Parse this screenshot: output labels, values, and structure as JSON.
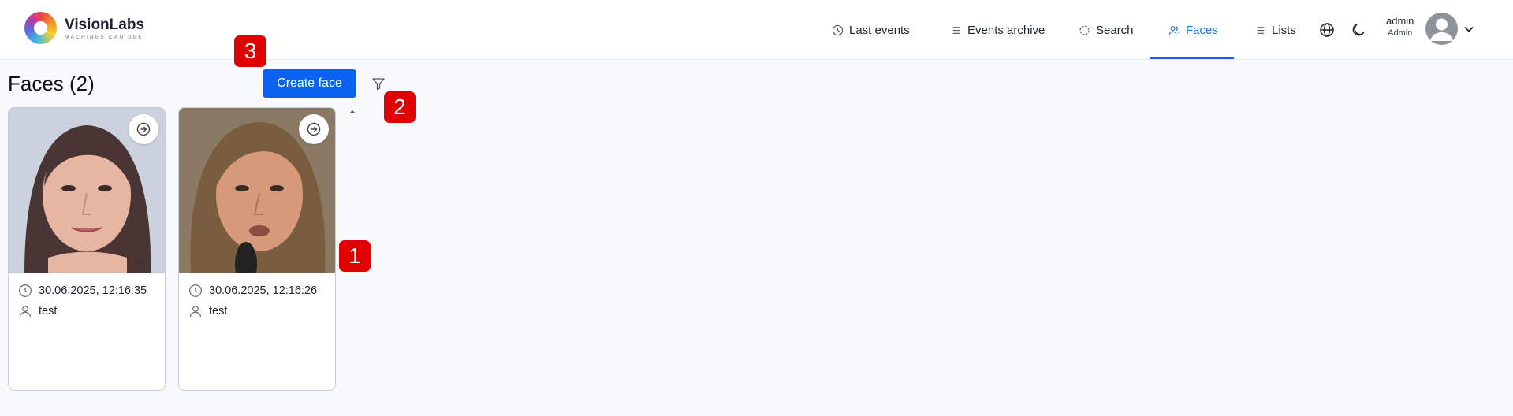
{
  "app": {
    "logo_title": "VisionLabs",
    "logo_subtitle": "MACHINES CAN SEE"
  },
  "nav": {
    "items": [
      {
        "label": "Last events",
        "icon": "clock-icon"
      },
      {
        "label": "Events archive",
        "icon": "list-icon"
      },
      {
        "label": "Search",
        "icon": "search-target-icon"
      },
      {
        "label": "Faces",
        "icon": "users-icon",
        "active": true
      },
      {
        "label": "Lists",
        "icon": "list-icon"
      }
    ]
  },
  "user": {
    "name": "admin",
    "role": "Admin"
  },
  "page": {
    "title": "Faces (2)",
    "create_label": "Create face"
  },
  "cards": [
    {
      "timestamp": "30.06.2025, 12:16:35",
      "name": "test"
    },
    {
      "timestamp": "30.06.2025, 12:16:26",
      "name": "test"
    }
  ],
  "annotations": [
    "1",
    "2",
    "3"
  ],
  "colors": {
    "accent": "#0b62f0",
    "active_nav": "#1a73e8",
    "badge": "#e00000",
    "background": "#f7f9fc"
  }
}
